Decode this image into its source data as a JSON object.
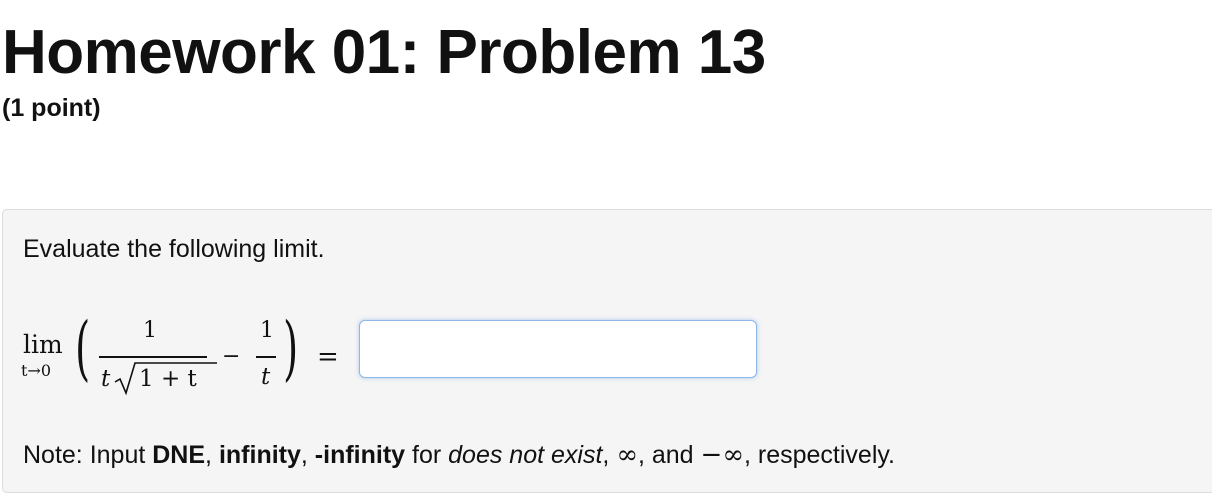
{
  "header": {
    "title": "Homework 01: Problem 13",
    "points": "(1 point)"
  },
  "problem": {
    "instruction": "Evaluate the following limit.",
    "math": {
      "lim": "lim",
      "lim_sub": "t→0",
      "left_paren": "(",
      "right_paren": ")",
      "numerator_1": "1",
      "denominator_t": "t",
      "denominator_sqrt": "1 + t",
      "minus": "−",
      "numerator_2": "1",
      "denominator_2": "t",
      "equals": "="
    },
    "answer": {
      "value": "",
      "placeholder": ""
    },
    "note": {
      "prefix": "Note: Input ",
      "dne": "DNE",
      "sep1": ", ",
      "infinity": "infinity",
      "sep2": ", ",
      "neg_infinity": "-infinity",
      "for_text": " for ",
      "does_not_exist": "does not exist",
      "sep3": ", ",
      "inf_symbol": "∞",
      "and_text": ", and ",
      "neg_inf_symbol": "−∞",
      "suffix": ", respectively."
    }
  }
}
